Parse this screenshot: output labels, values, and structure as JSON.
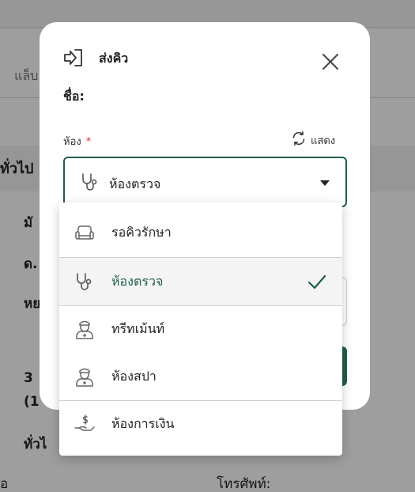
{
  "background": {
    "tab_label": "แล็บ",
    "section_title": "ทั่วไป",
    "text_1": "มั",
    "text_2": "ด.",
    "text_3": "หย",
    "text_4": "3",
    "text_5": "(1",
    "text_6": "ทั่วไ",
    "text_7": "อ",
    "phone_label": "โทรศัพท์:"
  },
  "modal": {
    "title": "ส่งคิว",
    "header_icon": "send-queue-icon",
    "close_icon": "close-icon",
    "name_label": "ชื่อ:",
    "room_label": "ห้อง",
    "required_mark": "*",
    "show_button_label": "แสดง",
    "show_icon": "refresh-icon",
    "selected_room": "ห้องตรวจ",
    "selected_icon": "stethoscope-icon"
  },
  "dropdown": {
    "options": [
      {
        "label": "รอคิวรักษา",
        "icon": "armchair-icon",
        "selected": false
      },
      {
        "label": "ห้องตรวจ",
        "icon": "stethoscope-icon",
        "selected": true
      },
      {
        "label": "ทรีทเม้นท์",
        "icon": "nurse-icon",
        "selected": false
      },
      {
        "label": "ห้องสปา",
        "icon": "nurse-icon",
        "selected": false
      },
      {
        "label": "ห้องการเงิน",
        "icon": "money-hand-icon",
        "selected": false
      }
    ],
    "check_icon": "check-icon"
  },
  "colors": {
    "accent": "#1f5e4a",
    "required": "#d32f2f"
  }
}
